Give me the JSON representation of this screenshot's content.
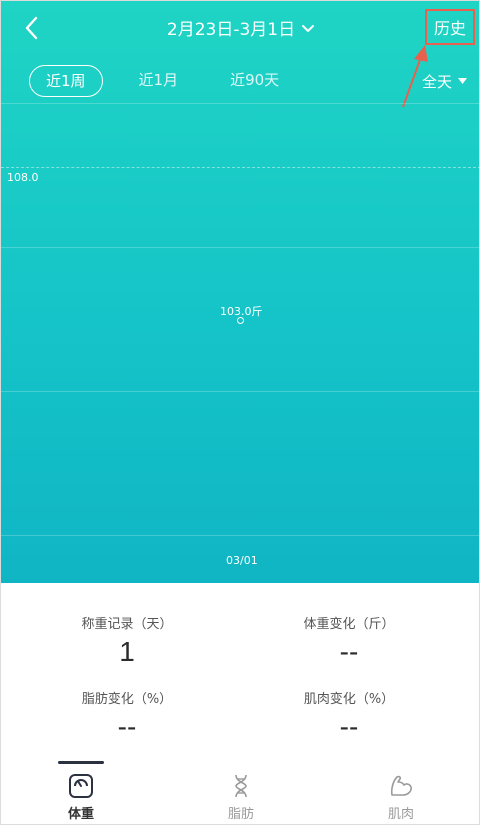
{
  "header": {
    "date_range": "2月23日-3月1日",
    "history_label": "历史"
  },
  "range_tabs": [
    {
      "label": "近1周",
      "active": true
    },
    {
      "label": "近1月",
      "active": false
    },
    {
      "label": "近90天",
      "active": false
    }
  ],
  "day_filter": "全天",
  "chart_data": {
    "type": "line",
    "x": [
      "03/01"
    ],
    "series": [
      {
        "values": [
          103.0
        ]
      }
    ],
    "y_reference_label": "108.0",
    "point_label": "103.0斤",
    "grid": true
  },
  "stats": {
    "weigh_records": {
      "label": "称重记录（天）",
      "value": "1"
    },
    "weight_change": {
      "label": "体重变化（斤）",
      "value": "--"
    },
    "fat_change": {
      "label": "脂肪变化（%）",
      "value": "--"
    },
    "muscle_change": {
      "label": "肌肉变化（%）",
      "value": "--"
    }
  },
  "nav": [
    {
      "label": "体重",
      "icon": "scale-icon",
      "active": true
    },
    {
      "label": "脂肪",
      "icon": "dna-icon",
      "active": false
    },
    {
      "label": "肌肉",
      "icon": "muscle-icon",
      "active": false
    }
  ],
  "colors": {
    "hero_top": "#1fd4c4",
    "hero_bottom": "#10b5c4",
    "annotation": "#e8614e"
  }
}
